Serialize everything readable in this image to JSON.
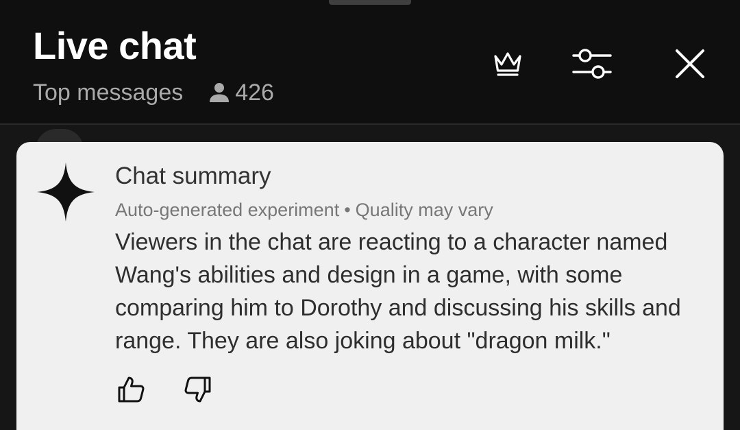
{
  "header": {
    "title": "Live chat",
    "mode_label": "Top messages",
    "viewer_count": "426",
    "viewer_icon": "person-icon",
    "actions": [
      {
        "name": "crown-icon"
      },
      {
        "name": "filter-sliders-icon"
      },
      {
        "name": "close-icon"
      }
    ]
  },
  "summary": {
    "icon": "sparkle-icon",
    "title": "Chat summary",
    "meta_source": "Auto-generated experiment",
    "meta_separator": "•",
    "meta_quality": "Quality may vary",
    "body": "Viewers in the chat are reacting to a character named Wang's abilities and design in a game, with some comparing him to Dorothy and discussing his skills and range. They are also joking about \"dragon milk.\"",
    "feedback": [
      {
        "name": "thumbs-up-icon"
      },
      {
        "name": "thumbs-down-icon"
      }
    ]
  },
  "colors": {
    "header_bg": "#0f0f0f",
    "card_bg": "#f0f0f0",
    "title_text": "#ffffff",
    "muted_text": "#aaaaaa"
  }
}
